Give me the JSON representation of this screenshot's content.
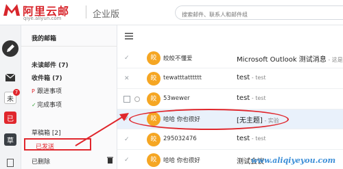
{
  "header": {
    "logo_text": "阿里云邮",
    "logo_url": "qiye.aliyun.com",
    "edition": "企业版",
    "search_placeholder": "搜索邮件、联系人和邮件组"
  },
  "rail": {
    "items": [
      {
        "icon": "pencil-icon"
      },
      {
        "icon": "mail-icon"
      },
      {
        "label": "未",
        "badge": "7"
      },
      {
        "label": "已"
      },
      {
        "label": "草"
      }
    ]
  },
  "folders": {
    "title": "我的邮箱",
    "unread": "未读邮件 (7)",
    "inbox": "收件箱 (7)",
    "followup_mark": "P",
    "followup": "跟进事项",
    "done_mark": "✓",
    "done": "完成事项",
    "drafts": "草稿箱 [2]",
    "sent": "已发送",
    "deleted": "已删除"
  },
  "messages": [
    {
      "check": "✓",
      "avatar": "皎",
      "sender": "皎皎不懂爱",
      "subject": "Microsoft Outlook 测试消息",
      "snippet": " - 这是在..."
    },
    {
      "check": "✕",
      "avatar": "皎",
      "sender": "tewatttatttttt",
      "subject": "test",
      "snippet": " - test"
    },
    {
      "check": "",
      "avatar": "皎",
      "sender": "53wewer",
      "subject": "test",
      "snippet": " - test"
    },
    {
      "check": "✓",
      "avatar": "皎",
      "sender": "哈哈 你也很好",
      "subject": "[无主题]",
      "snippet": " - 实验"
    },
    {
      "check": "✓",
      "avatar": "皎",
      "sender": "295032476",
      "subject": "test",
      "snippet": " - test"
    },
    {
      "check": "✓",
      "avatar": "皎",
      "sender": "哈哈 你也很好",
      "subject": "测试会议",
      "snippet": ""
    }
  ],
  "watermark": "www.aliqiyeyou.com",
  "colors": {
    "brand_red": "#d8262c",
    "avatar_orange": "#f5a623",
    "selected_row": "#e9f1fb",
    "annotation_red": "#e0262c",
    "watermark_blue": "#3d8fd8"
  }
}
